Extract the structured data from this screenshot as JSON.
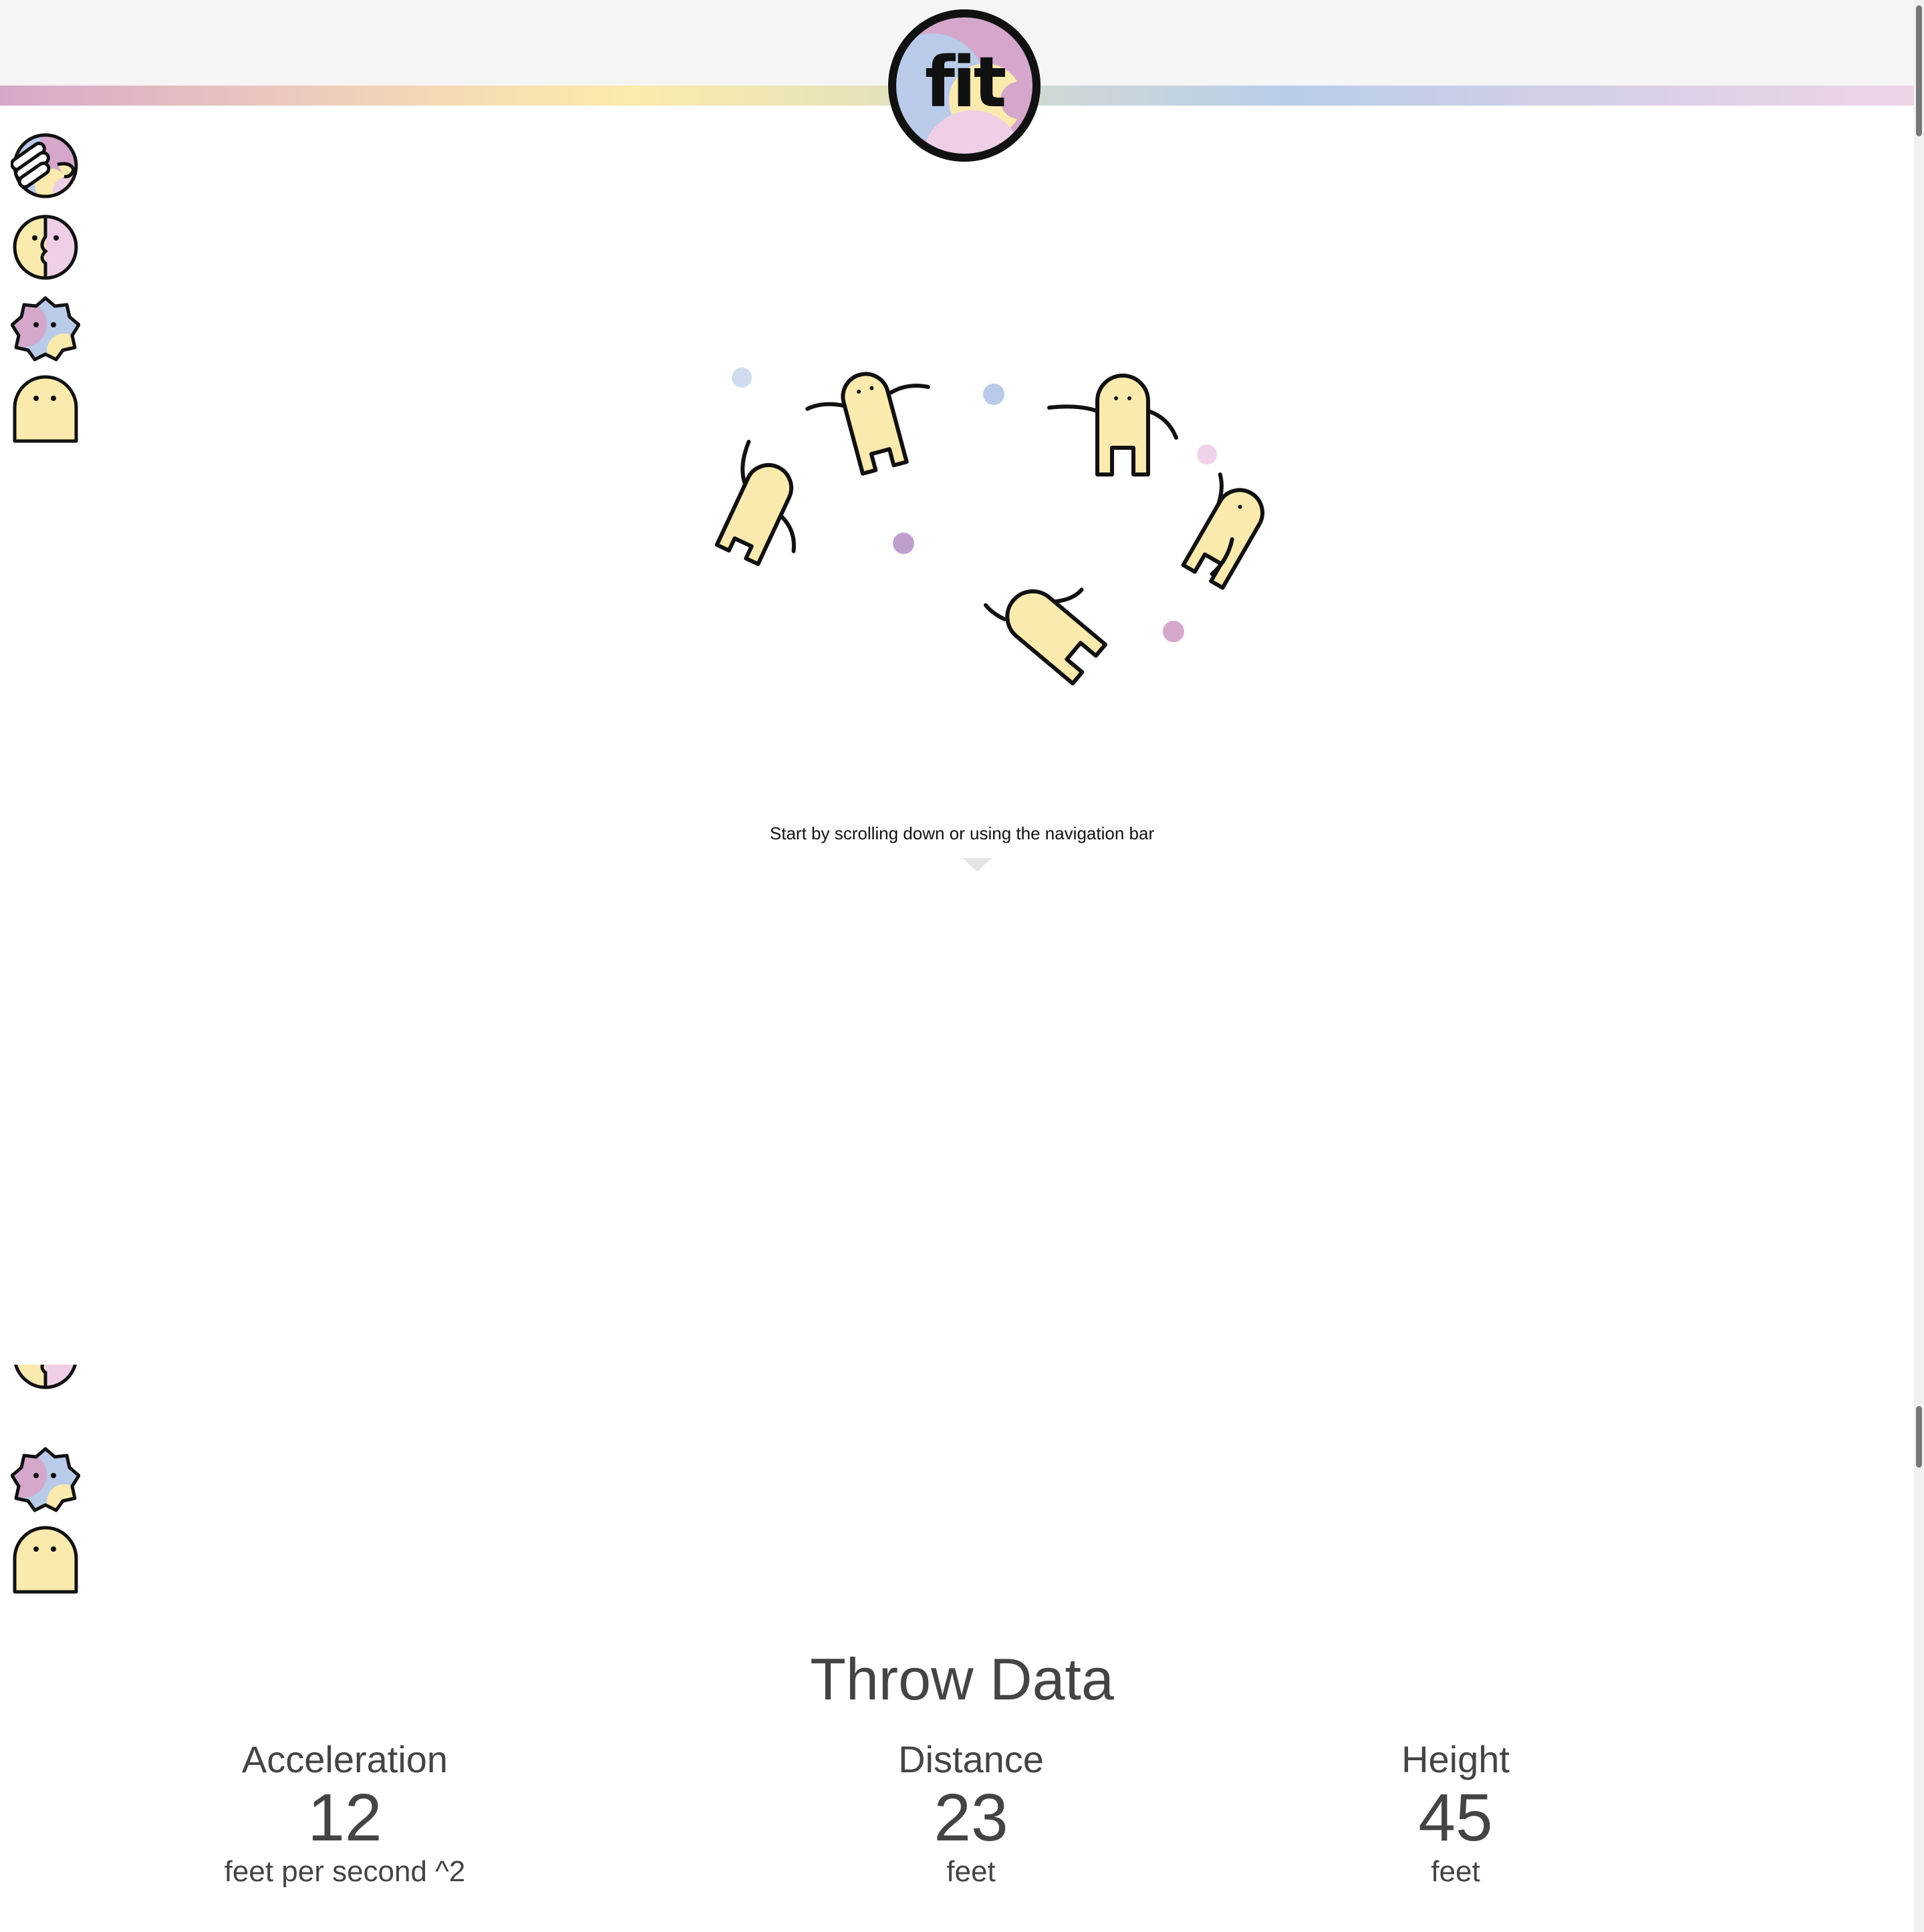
{
  "header": {
    "logo_text": "fit"
  },
  "nav": {
    "items": [
      {
        "icon": "clapping-hands-icon"
      },
      {
        "icon": "face-profile-icon"
      },
      {
        "icon": "splat-face-icon"
      },
      {
        "icon": "ghost-character-icon"
      }
    ]
  },
  "hero": {
    "hint": "Start by scrolling down or using the navigation bar"
  },
  "throw_data": {
    "title": "Throw Data",
    "stats": [
      {
        "label": "Acceleration",
        "value": "12",
        "unit": "feet per second ^2"
      },
      {
        "label": "Distance",
        "value": "23",
        "unit": "feet"
      },
      {
        "label": "Height",
        "value": "45",
        "unit": "feet"
      }
    ]
  },
  "colors": {
    "character_fill": "#fcebaa",
    "outline": "#111111",
    "pink": "#d9a8cc",
    "blue": "#b8cbe8",
    "yellow": "#fcebaa",
    "purple": "#bfa0cc",
    "text_dark": "#444444"
  }
}
